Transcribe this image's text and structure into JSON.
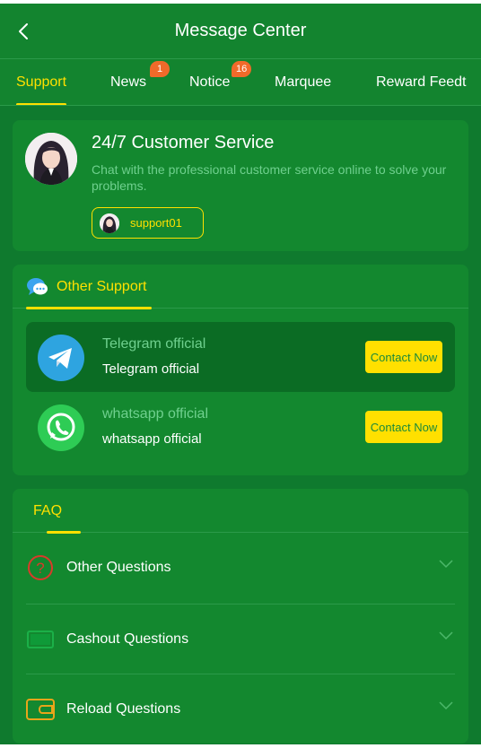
{
  "header": {
    "title": "Message Center"
  },
  "tabs": [
    {
      "label": "Support",
      "active": true
    },
    {
      "label": "News",
      "badge": "1"
    },
    {
      "label": "Notice",
      "badge": "16"
    },
    {
      "label": "Marquee"
    },
    {
      "label": "Reward Feedt"
    }
  ],
  "customer_service": {
    "title": "24/7 Customer Service",
    "description": "Chat with the professional customer service online to solve your problems.",
    "agent": "support01"
  },
  "other_support": {
    "heading": "Other Support",
    "channels": [
      {
        "name": "Telegram official",
        "label": "Telegram official",
        "button": "Contact Now",
        "icon": "telegram-icon"
      },
      {
        "name": "whatsapp official",
        "label": "whatsapp official",
        "button": "Contact Now",
        "icon": "whatsapp-icon"
      }
    ]
  },
  "faq": {
    "heading": "FAQ",
    "items": [
      {
        "label": "Other Questions",
        "icon": "question-icon"
      },
      {
        "label": "Cashout Questions",
        "icon": "cash-icon"
      },
      {
        "label": "Reload Questions",
        "icon": "wallet-icon"
      }
    ]
  },
  "colors": {
    "background": "#0f7a2e",
    "card": "#13882f",
    "accent": "#ffe000",
    "badge": "#f06a2a",
    "muted_text": "#6fd08e"
  }
}
